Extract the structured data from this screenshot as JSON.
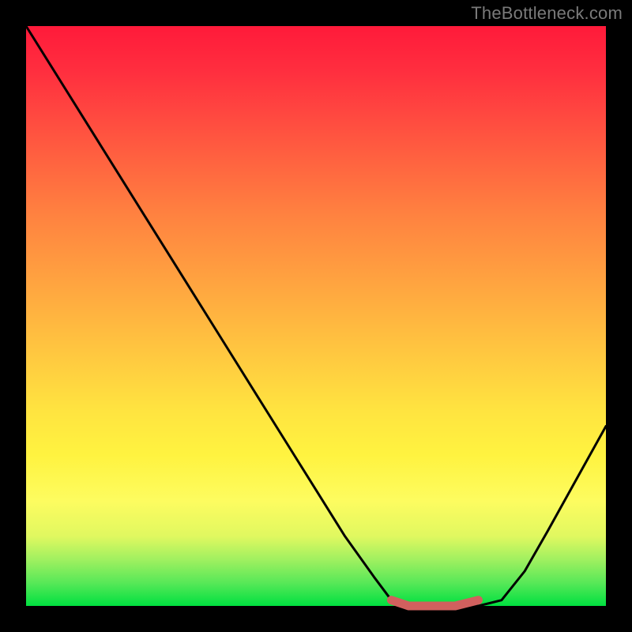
{
  "watermark": "TheBottleneck.com",
  "chart_data": {
    "type": "line",
    "title": "",
    "xlabel": "",
    "ylabel": "",
    "xlim": [
      0,
      100
    ],
    "ylim": [
      0,
      100
    ],
    "series": [
      {
        "name": "bottleneck-curve",
        "x": [
          0,
          5,
          10,
          15,
          20,
          25,
          30,
          35,
          40,
          45,
          50,
          55,
          60,
          63,
          66,
          70,
          74,
          78,
          82,
          86,
          90,
          95,
          100
        ],
        "values": [
          100,
          92,
          84,
          76,
          68,
          60,
          52,
          44,
          36,
          28,
          20,
          12,
          5,
          1,
          0,
          0,
          0,
          0,
          1,
          6,
          13,
          22,
          31
        ]
      },
      {
        "name": "highlight-band",
        "x": [
          63,
          66,
          70,
          74,
          78
        ],
        "values": [
          1,
          0,
          0,
          0,
          1
        ]
      }
    ],
    "colors": {
      "curve": "#000000",
      "highlight": "#d1605e"
    }
  }
}
